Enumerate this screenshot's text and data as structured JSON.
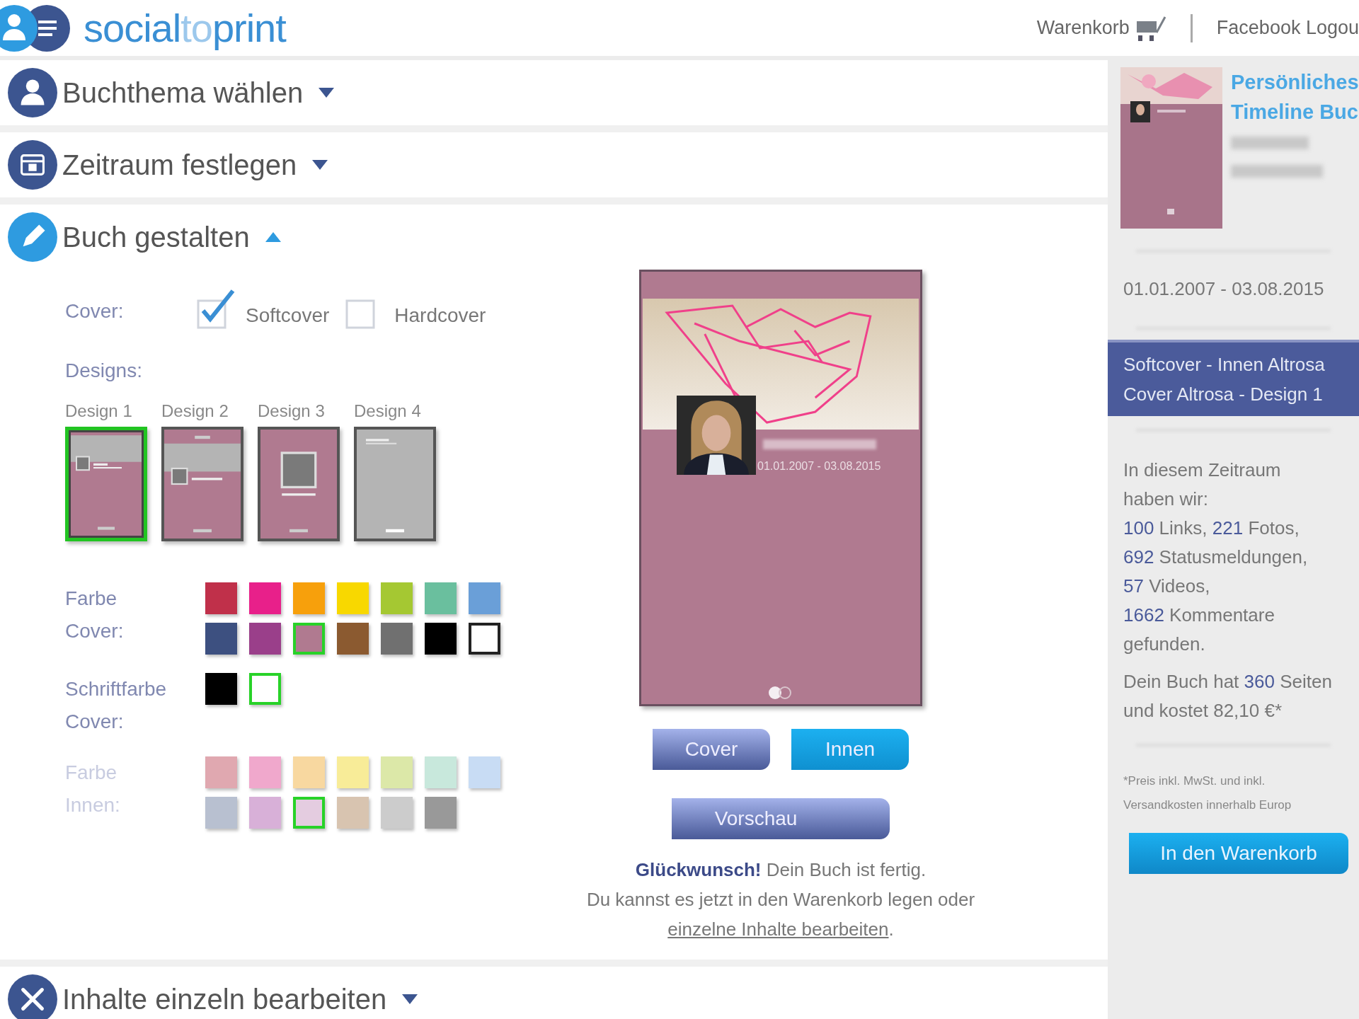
{
  "header": {
    "logo": [
      "social",
      "to",
      "print"
    ],
    "cart_link": "Warenkorb",
    "logout_link": "Facebook Logou"
  },
  "sections": [
    {
      "title": "Buchthema wählen",
      "expanded": false
    },
    {
      "title": "Zeitraum festlegen",
      "expanded": false
    },
    {
      "title": "Buch gestalten",
      "expanded": true
    },
    {
      "title": "Inhalte einzeln bearbeiten",
      "expanded": false
    }
  ],
  "editor": {
    "cover_label": "Cover:",
    "cover_options": [
      {
        "label": "Softcover",
        "checked": true
      },
      {
        "label": "Hardcover",
        "checked": false
      }
    ],
    "designs_label": "Designs:",
    "designs": [
      {
        "label": "Design 1",
        "kind": "banner",
        "selected": true
      },
      {
        "label": "Design 2",
        "kind": "band",
        "selected": false
      },
      {
        "label": "Design 3",
        "kind": "centered",
        "selected": false
      },
      {
        "label": "Design 4",
        "kind": "plain",
        "selected": false
      }
    ],
    "palettes": [
      {
        "label": "Farbe Cover:",
        "faded": false,
        "rows": [
          [
            {
              "color": "#c0304a",
              "selected": false
            },
            {
              "color": "#e8208a",
              "selected": false
            },
            {
              "color": "#f7a00c",
              "selected": false
            },
            {
              "color": "#f8d800",
              "selected": false
            },
            {
              "color": "#a5c832",
              "selected": false
            },
            {
              "color": "#6abf9e",
              "selected": false
            },
            {
              "color": "#6a9fd8",
              "selected": false
            }
          ],
          [
            {
              "color": "#3d5080",
              "selected": false
            },
            {
              "color": "#9a3f8a",
              "selected": false
            },
            {
              "color": "#b07a90",
              "selected": true
            },
            {
              "color": "#8b5a30",
              "selected": false
            },
            {
              "color": "#707070",
              "selected": false
            },
            {
              "color": "#000000",
              "selected": false
            },
            {
              "color": "#ffffff",
              "selected": false
            }
          ]
        ]
      },
      {
        "label": "Schriftfarbe Cover:",
        "faded": false,
        "rows": [
          [
            {
              "color": "#000000",
              "selected": false
            },
            {
              "color": "#ffffff",
              "selected": true
            }
          ]
        ]
      },
      {
        "label": "Farbe Innen:",
        "faded": true,
        "rows": [
          [
            {
              "color": "#e0a8b0",
              "selected": false
            },
            {
              "color": "#f0a8cc",
              "selected": false
            },
            {
              "color": "#f8d8a0",
              "selected": false
            },
            {
              "color": "#f8ec98",
              "selected": false
            },
            {
              "color": "#dce8a8",
              "selected": false
            },
            {
              "color": "#c8e8dc",
              "selected": false
            },
            {
              "color": "#c8dcf4",
              "selected": false
            }
          ],
          [
            {
              "color": "#b8c0d0",
              "selected": false
            },
            {
              "color": "#d8b0d8",
              "selected": false
            },
            {
              "color": "#e4cce0",
              "selected": true
            },
            {
              "color": "#d8c4b0",
              "selected": false
            },
            {
              "color": "#cccccc",
              "selected": false
            },
            {
              "color": "#999999",
              "selected": false
            }
          ]
        ]
      }
    ]
  },
  "preview": {
    "date_range": "01.01.2007 - 03.08.2015",
    "tabs": [
      {
        "label": "Cover",
        "selected": true
      },
      {
        "label": "Innen",
        "selected": false
      }
    ],
    "preview_button": "Vorschau",
    "message": {
      "headline": "**Glückwunsch!** Dein Buch ist fertig.",
      "text": "Du kannst es jetzt in den Warenkorb legen oder",
      "link": "einzelne Inhalte bearbeiten",
      "end": "."
    }
  },
  "sidebar": {
    "title": [
      "Persönliches",
      "Timeline Buc"
    ],
    "date_range": "01.01.2007 - 03.08.2015",
    "selection": [
      "Softcover - Innen Altrosa",
      "Cover Altrosa - Design 1"
    ],
    "stats": [
      [
        {
          "text": "In diesem Zeitraum",
          "accent": false
        }
      ],
      [
        {
          "text": "haben wir:",
          "accent": false
        }
      ],
      [
        {
          "text": "100",
          "accent": true
        },
        {
          "text": " Links, ",
          "accent": false
        },
        {
          "text": "221",
          "accent": true
        },
        {
          "text": " Fotos,",
          "accent": false
        }
      ],
      [
        {
          "text": "692",
          "accent": true
        },
        {
          "text": " Statusmeldungen,",
          "accent": false
        }
      ],
      [
        {
          "text": "57",
          "accent": true
        },
        {
          "text": " Videos,",
          "accent": false
        }
      ],
      [
        {
          "text": "1662",
          "accent": true
        },
        {
          "text": " Kommentare",
          "accent": false
        }
      ],
      [
        {
          "text": "gefunden.",
          "accent": false
        }
      ]
    ],
    "price": [
      [
        {
          "text": "Dein Buch hat ",
          "accent": false
        },
        {
          "text": "360",
          "accent": true
        },
        {
          "text": " Seiten",
          "accent": false
        }
      ],
      [
        {
          "text": "und kostet 82,10 €*",
          "accent": false
        }
      ]
    ],
    "footnote": [
      "*Preis inkl. MwSt. und inkl.",
      "Versandkosten innerhalb Europ"
    ],
    "cart_button": "In den Warenkorb"
  }
}
